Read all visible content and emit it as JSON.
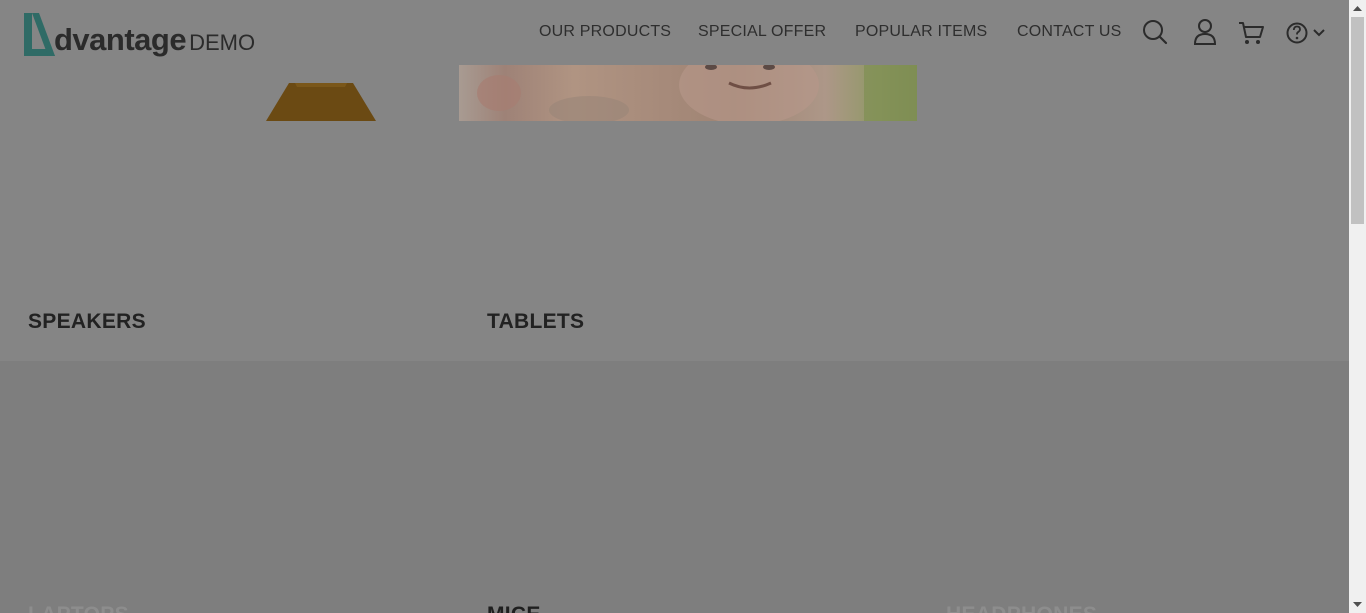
{
  "header": {
    "logo_word": "dvantage",
    "logo_demo": "DEMO",
    "nav": [
      {
        "label": "OUR PRODUCTS"
      },
      {
        "label": "SPECIAL OFFER"
      },
      {
        "label": "POPULAR ITEMS"
      },
      {
        "label": "CONTACT US"
      }
    ],
    "icons": [
      "search-icon",
      "user-icon",
      "cart-icon",
      "help-icon",
      "chevron-down-icon"
    ]
  },
  "categories": [
    {
      "label": "SPEAKERS"
    },
    {
      "label": "TABLETS"
    },
    {
      "label": "LAPTOPS"
    },
    {
      "label": "MICE"
    },
    {
      "label": "HEADPHONES"
    }
  ],
  "colors": {
    "overlay": "#7e7e7e",
    "brand_teal": "#2f6b66",
    "text_dark": "#222222"
  }
}
